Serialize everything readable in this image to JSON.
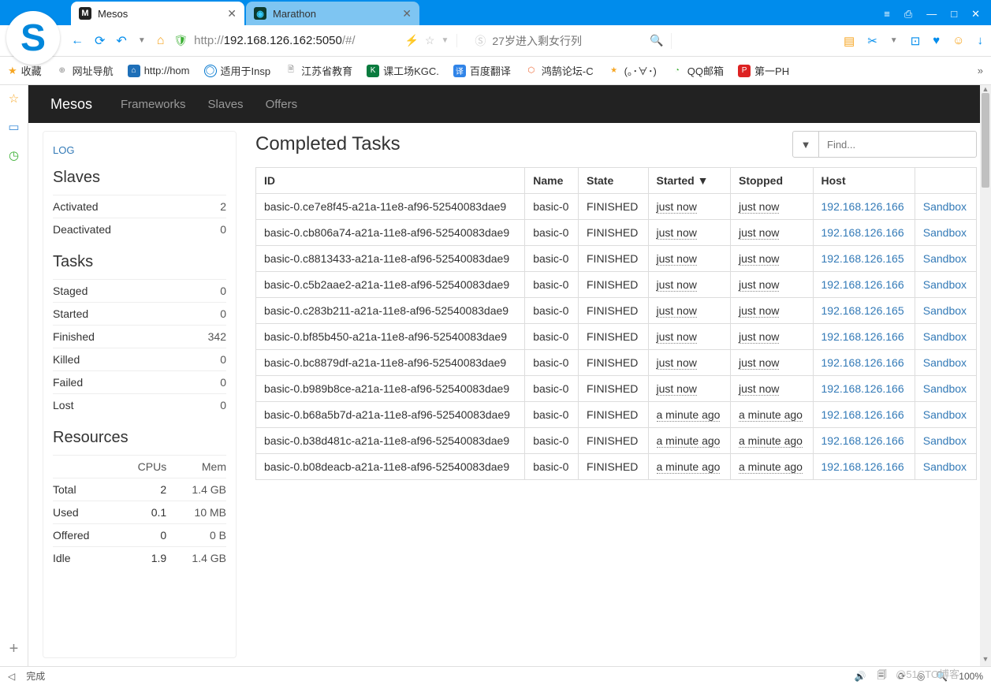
{
  "browser": {
    "tabs": [
      {
        "title": "Mesos",
        "active": true
      },
      {
        "title": "Marathon",
        "active": false
      }
    ],
    "url_prefix": "http://",
    "url_host": "192.168.126.162:5050",
    "url_path": "/#/",
    "search_placeholder": "27岁进入剩女行列",
    "win": {
      "menu": "≡",
      "tshirt": "👕",
      "min": "—",
      "max": "□",
      "close": "✕"
    }
  },
  "bookmarks": {
    "fav": "收藏",
    "items": [
      "网址导航",
      "http://hom",
      "适用于Insp",
      "江苏省教育",
      "课工场KGC.",
      "百度翻译",
      "鸿鹄论坛-C",
      "(｡･∀･)",
      "QQ邮箱",
      "第一PH"
    ]
  },
  "nav": {
    "brand": "Mesos",
    "links": [
      "Frameworks",
      "Slaves",
      "Offers"
    ]
  },
  "sidebar": {
    "log": "LOG",
    "slaves": {
      "title": "Slaves",
      "rows": [
        [
          "Activated",
          "2"
        ],
        [
          "Deactivated",
          "0"
        ]
      ]
    },
    "tasks": {
      "title": "Tasks",
      "rows": [
        [
          "Staged",
          "0"
        ],
        [
          "Started",
          "0"
        ],
        [
          "Finished",
          "342"
        ],
        [
          "Killed",
          "0"
        ],
        [
          "Failed",
          "0"
        ],
        [
          "Lost",
          "0"
        ]
      ]
    },
    "resources": {
      "title": "Resources",
      "headers": [
        "",
        "CPUs",
        "Mem"
      ],
      "rows": [
        [
          "Total",
          "2",
          "1.4 GB"
        ],
        [
          "Used",
          "0.1",
          "10 MB"
        ],
        [
          "Offered",
          "0",
          "0 B"
        ],
        [
          "Idle",
          "1.9",
          "1.4 GB"
        ]
      ]
    }
  },
  "main": {
    "title": "Completed Tasks",
    "find_placeholder": "Find...",
    "headers": [
      "ID",
      "Name",
      "State",
      "Started ▼",
      "Stopped",
      "Host",
      ""
    ],
    "sandbox": "Sandbox",
    "rows": [
      {
        "id": "basic-0.ce7e8f45-a21a-11e8-af96-52540083dae9",
        "name": "basic-0",
        "state": "FINISHED",
        "started": "just now",
        "stopped": "just now",
        "host": "192.168.126.166"
      },
      {
        "id": "basic-0.cb806a74-a21a-11e8-af96-52540083dae9",
        "name": "basic-0",
        "state": "FINISHED",
        "started": "just now",
        "stopped": "just now",
        "host": "192.168.126.166"
      },
      {
        "id": "basic-0.c8813433-a21a-11e8-af96-52540083dae9",
        "name": "basic-0",
        "state": "FINISHED",
        "started": "just now",
        "stopped": "just now",
        "host": "192.168.126.165"
      },
      {
        "id": "basic-0.c5b2aae2-a21a-11e8-af96-52540083dae9",
        "name": "basic-0",
        "state": "FINISHED",
        "started": "just now",
        "stopped": "just now",
        "host": "192.168.126.166"
      },
      {
        "id": "basic-0.c283b211-a21a-11e8-af96-52540083dae9",
        "name": "basic-0",
        "state": "FINISHED",
        "started": "just now",
        "stopped": "just now",
        "host": "192.168.126.165"
      },
      {
        "id": "basic-0.bf85b450-a21a-11e8-af96-52540083dae9",
        "name": "basic-0",
        "state": "FINISHED",
        "started": "just now",
        "stopped": "just now",
        "host": "192.168.126.166"
      },
      {
        "id": "basic-0.bc8879df-a21a-11e8-af96-52540083dae9",
        "name": "basic-0",
        "state": "FINISHED",
        "started": "just now",
        "stopped": "just now",
        "host": "192.168.126.166"
      },
      {
        "id": "basic-0.b989b8ce-a21a-11e8-af96-52540083dae9",
        "name": "basic-0",
        "state": "FINISHED",
        "started": "just now",
        "stopped": "just now",
        "host": "192.168.126.166"
      },
      {
        "id": "basic-0.b68a5b7d-a21a-11e8-af96-52540083dae9",
        "name": "basic-0",
        "state": "FINISHED",
        "started": "a minute ago",
        "stopped": "a minute ago",
        "host": "192.168.126.166"
      },
      {
        "id": "basic-0.b38d481c-a21a-11e8-af96-52540083dae9",
        "name": "basic-0",
        "state": "FINISHED",
        "started": "a minute ago",
        "stopped": "a minute ago",
        "host": "192.168.126.166"
      },
      {
        "id": "basic-0.b08deacb-a21a-11e8-af96-52540083dae9",
        "name": "basic-0",
        "state": "FINISHED",
        "started": "a minute ago",
        "stopped": "a minute ago",
        "host": "192.168.126.166"
      }
    ]
  },
  "status": {
    "left_chev": "◁",
    "done": "完成",
    "zoom": "100%",
    "watermark": "@51CTO博客"
  }
}
